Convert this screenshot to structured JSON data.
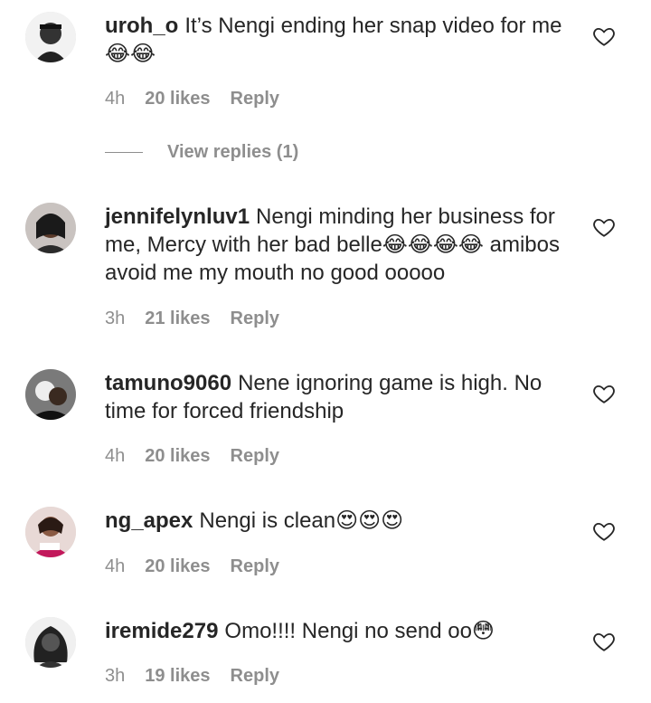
{
  "comments": [
    {
      "username": "uroh_o",
      "text": "It’s Nengi ending her snap video for me 😂😂",
      "time": "4h",
      "likes": "20 likes",
      "reply": "Reply",
      "view_replies": "View replies (1)"
    },
    {
      "username": "jennifelynluv1",
      "text": "Nengi minding her business for me, Mercy with her bad belle😂😂😂😂 amibos avoid me my mouth no good ooooo",
      "time": "3h",
      "likes": "21 likes",
      "reply": "Reply"
    },
    {
      "username": "tamuno9060",
      "text": "Nene ignoring game is high. No time for forced friendship",
      "time": "4h",
      "likes": "20 likes",
      "reply": "Reply"
    },
    {
      "username": "ng_apex",
      "text": "Nengi is clean😍😍😍",
      "time": "4h",
      "likes": "20 likes",
      "reply": "Reply"
    },
    {
      "username": "iremide279",
      "text": "Omo!!!! Nengi no send oo😳",
      "time": "3h",
      "likes": "19 likes",
      "reply": "Reply"
    }
  ],
  "icons": {
    "like": "heart-outline-icon"
  },
  "colors": {
    "text": "#262626",
    "meta": "#8e8e8e"
  }
}
